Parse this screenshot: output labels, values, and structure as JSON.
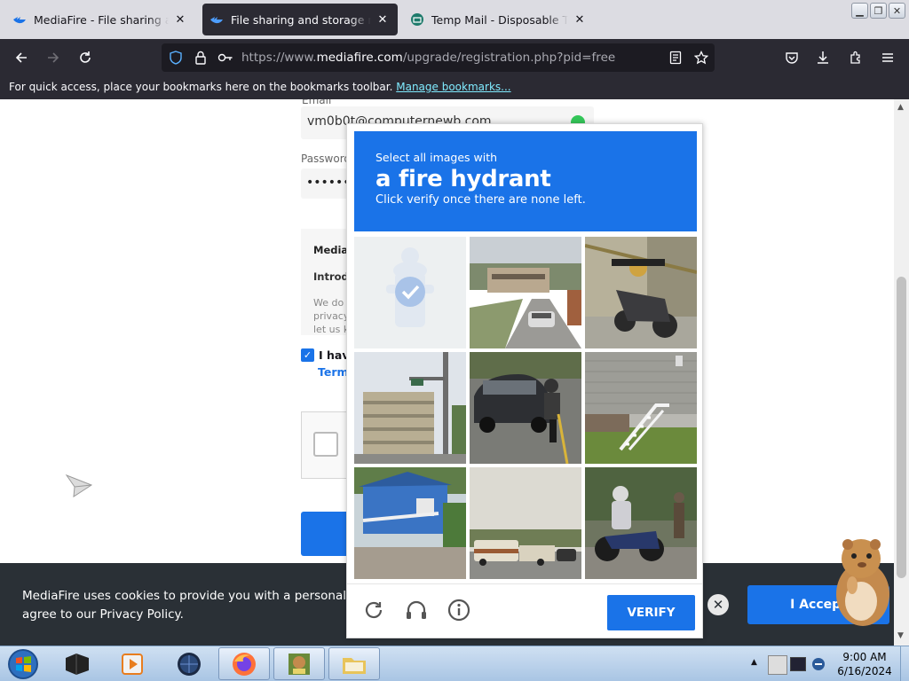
{
  "tabs": [
    {
      "title": "MediaFire - File sharing and storage made simple",
      "active": false,
      "favicon": "mediafire-icon"
    },
    {
      "title": "File sharing and storage made simple",
      "active": true,
      "favicon": "mediafire-icon"
    },
    {
      "title": "Temp Mail - Disposable Temporary Email",
      "active": false,
      "favicon": "tempmail-icon"
    }
  ],
  "address_bar": {
    "url_prefix": "https://www.",
    "url_domain": "mediafire.com",
    "url_path": "/upgrade/registration.php?pid=free"
  },
  "bookmarks_bar": {
    "message": "For quick access, place your bookmarks here on the bookmarks toolbar.",
    "link": "Manage bookmarks..."
  },
  "form": {
    "email_label": "Email",
    "email_value": "vm0b0t@computernewb.com",
    "password_label": "Password",
    "password_value": "••••••",
    "terms_title": "Mediafire",
    "terms_intro": "Introduction",
    "terms_body_1": "We do",
    "terms_body_2": "privacy",
    "terms_body_3": "let us k",
    "agree_label": "I have",
    "terms_link": "Terms"
  },
  "captcha": {
    "instruction": "Select all images with",
    "target": "a fire hydrant",
    "subtext": "Click verify once there are none left.",
    "verify_label": "VERIFY",
    "tiles": [
      {
        "content": "fire hydrant",
        "selected": true
      },
      {
        "content": "street with car",
        "selected": false
      },
      {
        "content": "motorcycle",
        "selected": false
      },
      {
        "content": "buildings and street lamp",
        "selected": false
      },
      {
        "content": "car and motorcyclist",
        "selected": false
      },
      {
        "content": "house with stairs",
        "selected": false
      },
      {
        "content": "blue house",
        "selected": false
      },
      {
        "content": "road with RV",
        "selected": false
      },
      {
        "content": "motorcyclist",
        "selected": false
      }
    ]
  },
  "cookie_banner": {
    "text_1": "MediaFire uses cookies to provide you with a personalized br",
    "text_2": "agree to our Privacy Policy.",
    "accept_label": "I Accept"
  },
  "taskbar": {
    "time": "9:00 AM",
    "date": "6/16/2024"
  },
  "colors": {
    "captcha_blue": "#1a73e8",
    "browser_dark": "#2b2a33",
    "cookie_bg": "#2a3036"
  }
}
